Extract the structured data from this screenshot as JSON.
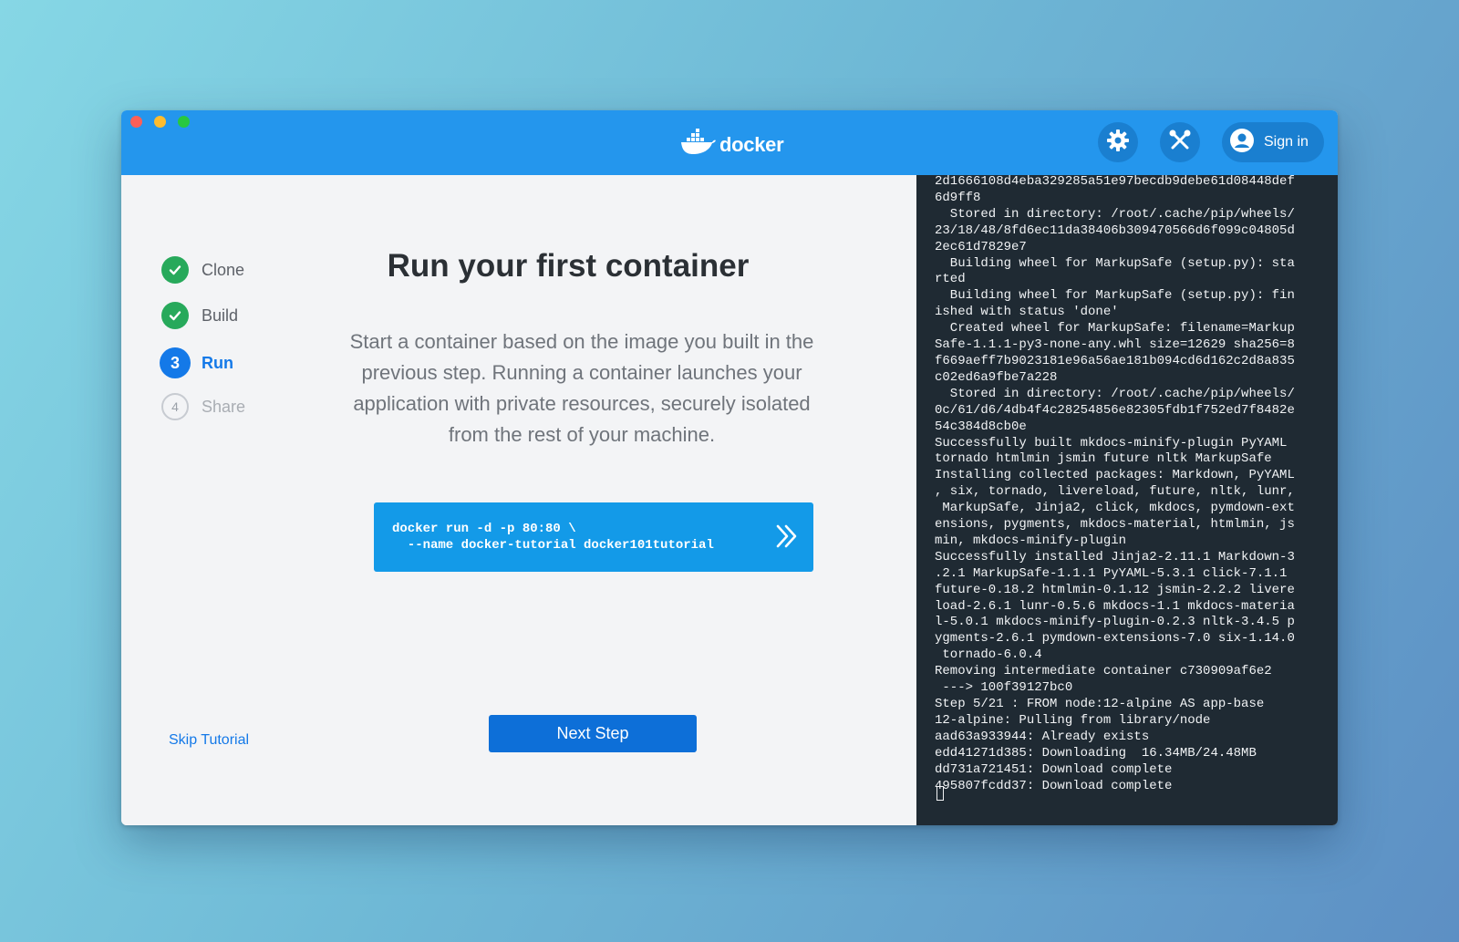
{
  "window": {
    "brand": "docker",
    "signin_label": "Sign in",
    "icons": [
      "docker-whale-icon",
      "settings-gear-icon",
      "tools-icon",
      "account-icon"
    ]
  },
  "steps": [
    {
      "label": "Clone",
      "state": "done"
    },
    {
      "label": "Build",
      "state": "done"
    },
    {
      "label": "Run",
      "state": "current",
      "number": "3"
    },
    {
      "label": "Share",
      "state": "pending",
      "number": "4"
    }
  ],
  "main": {
    "title": "Run your first container",
    "description": "Start a container based on the image you built in the previous step. Running a container launches your application with private resources, securely isolated from the rest of your machine.",
    "command_lines": [
      "docker run -d -p 80:80 \\",
      "  --name docker-tutorial docker101tutorial"
    ],
    "skip_label": "Skip Tutorial",
    "next_label": "Next Step"
  },
  "terminal": {
    "lines": [
      "2d1666108d4eba329285a51e97becdb9debe61d08448def",
      "6d9ff8",
      "  Stored in directory: /root/.cache/pip/wheels/",
      "23/18/48/8fd6ec11da38406b309470566d6f099c04805d",
      "2ec61d7829e7",
      "  Building wheel for MarkupSafe (setup.py): sta",
      "rted",
      "  Building wheel for MarkupSafe (setup.py): fin",
      "ished with status 'done'",
      "  Created wheel for MarkupSafe: filename=Markup",
      "Safe-1.1.1-py3-none-any.whl size=12629 sha256=8",
      "f669aeff7b9023181e96a56ae181b094cd6d162c2d8a835",
      "c02ed6a9fbe7a228",
      "  Stored in directory: /root/.cache/pip/wheels/",
      "0c/61/d6/4db4f4c28254856e82305fdb1f752ed7f8482e",
      "54c384d8cb0e",
      "Successfully built mkdocs-minify-plugin PyYAML",
      "tornado htmlmin jsmin future nltk MarkupSafe",
      "Installing collected packages: Markdown, PyYAML",
      ", six, tornado, livereload, future, nltk, lunr,",
      " MarkupSafe, Jinja2, click, mkdocs, pymdown-ext",
      "ensions, pygments, mkdocs-material, htmlmin, js",
      "min, mkdocs-minify-plugin",
      "Successfully installed Jinja2-2.11.1 Markdown-3",
      ".2.1 MarkupSafe-1.1.1 PyYAML-5.3.1 click-7.1.1",
      "future-0.18.2 htmlmin-0.1.12 jsmin-2.2.2 livere",
      "load-2.6.1 lunr-0.5.6 mkdocs-1.1 mkdocs-materia",
      "l-5.0.1 mkdocs-minify-plugin-0.2.3 nltk-3.4.5 p",
      "ygments-2.6.1 pymdown-extensions-7.0 six-1.14.0",
      " tornado-6.0.4",
      "Removing intermediate container c730909af6e2",
      " ---> 100f39127bc0",
      "Step 5/21 : FROM node:12-alpine AS app-base",
      "12-alpine: Pulling from library/node",
      "aad63a933944: Already exists",
      "edd41271d385: Downloading  16.34MB/24.48MB",
      "dd731a721451: Download complete",
      "495807fcdd37: Download complete"
    ]
  },
  "colors": {
    "header": "#2496ed",
    "accent": "#1479e8",
    "success": "#27a95b",
    "terminal_bg": "#1f2a33",
    "command_bg": "#139ae8"
  }
}
